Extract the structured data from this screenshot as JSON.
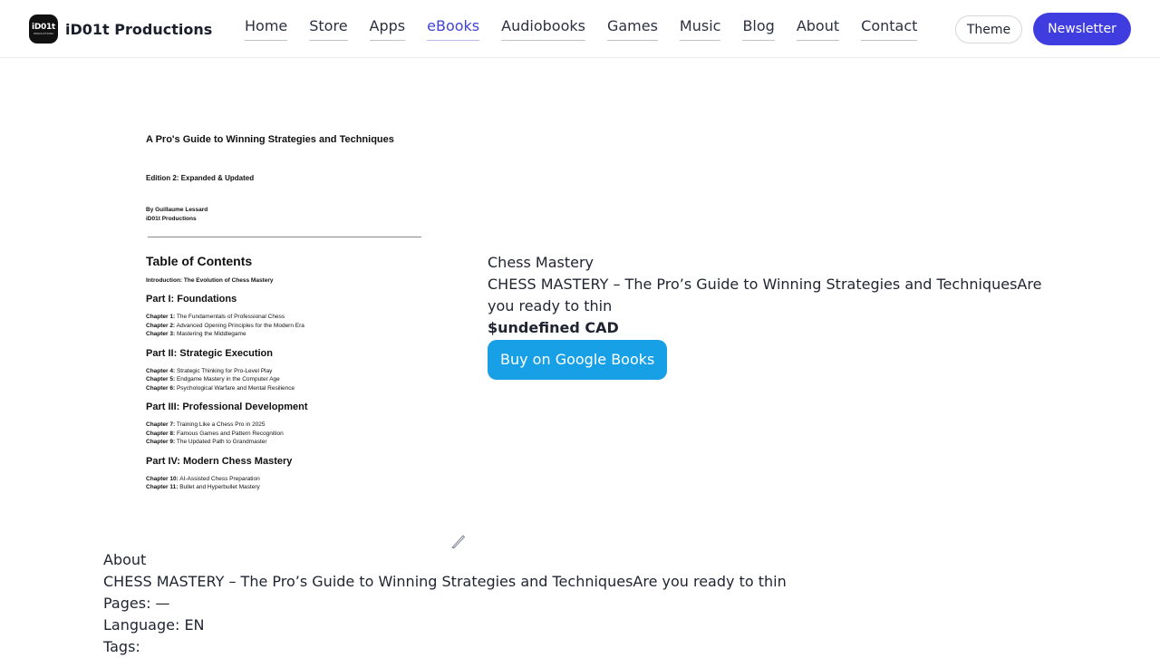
{
  "header": {
    "logo_line1": "iD01t",
    "logo_line2": "PRODUCTIONS",
    "brand": "iD01t Productions",
    "nav": [
      "Home",
      "Store",
      "Apps",
      "eBooks",
      "Audiobooks",
      "Games",
      "Music",
      "Blog",
      "About",
      "Contact"
    ],
    "active_nav": "eBooks",
    "theme_label": "Theme",
    "newsletter_label": "Newsletter"
  },
  "cover": {
    "title": "A Pro's Guide to Winning Strategies and Techniques",
    "edition": "Edition 2: Expanded & Updated",
    "author": "By Guillaume Lessard",
    "publisher": "iD01t Productions",
    "toc_heading": "Table of Contents",
    "intro": "Introduction: The Evolution of Chess Mastery",
    "parts": [
      {
        "title": "Part I: Foundations",
        "chapters": [
          {
            "num": "Chapter 1:",
            "title": "The Fundamentals of Professional Chess"
          },
          {
            "num": "Chapter 2:",
            "title": "Advanced Opening Principles for the Modern Era"
          },
          {
            "num": "Chapter 3:",
            "title": "Mastering the Middlegame"
          }
        ]
      },
      {
        "title": "Part II: Strategic Execution",
        "chapters": [
          {
            "num": "Chapter 4:",
            "title": "Strategic Thinking for Pro-Level Play"
          },
          {
            "num": "Chapter 5:",
            "title": "Endgame Mastery in the Computer Age"
          },
          {
            "num": "Chapter 6:",
            "title": "Psychological Warfare and Mental Resilience"
          }
        ]
      },
      {
        "title": "Part III: Professional Development",
        "chapters": [
          {
            "num": "Chapter 7:",
            "title": "Training Like a Chess Pro in 2025"
          },
          {
            "num": "Chapter 8:",
            "title": "Famous Games and Pattern Recognition"
          },
          {
            "num": "Chapter 9:",
            "title": "The Updated Path to Grandmaster"
          }
        ]
      },
      {
        "title": "Part IV: Modern Chess Mastery",
        "chapters": [
          {
            "num": "Chapter 10:",
            "title": "AI-Assisted Chess Preparation"
          },
          {
            "num": "Chapter 11:",
            "title": "Bullet and Hyperbullet Mastery"
          }
        ]
      }
    ]
  },
  "product": {
    "name": "Chess Mastery",
    "description": "CHESS MASTERY – The Pro’s Guide to Winning Strategies and TechniquesAre you ready to thin",
    "price": "$undefined CAD",
    "buy_label": "Buy on Google Books"
  },
  "about": {
    "heading": "About",
    "description": "CHESS MASTERY – The Pro’s Guide to Winning Strategies and TechniquesAre you ready to thin",
    "pages": "Pages: —",
    "language": "Language: EN",
    "tags": "Tags:"
  },
  "colors": {
    "accent": "#3f3de0",
    "buy_button": "#18a0e6",
    "active_nav": "#3f43d6"
  }
}
